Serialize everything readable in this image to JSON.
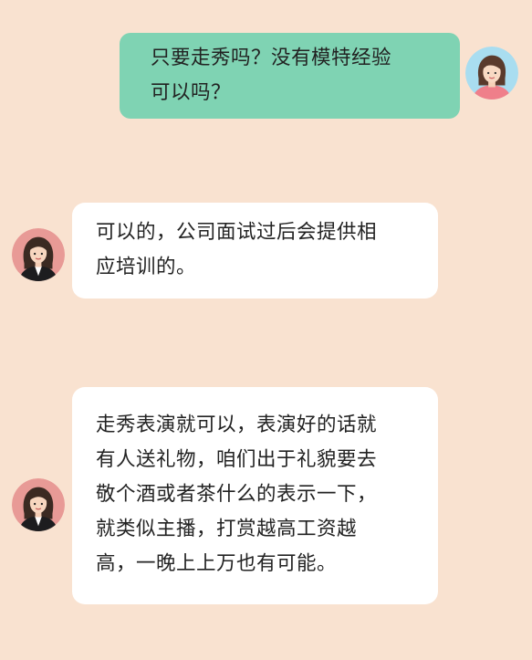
{
  "chat": {
    "messages": [
      {
        "sender": "user",
        "text": "只要走秀吗？没有模特经验\n可以吗？"
      },
      {
        "sender": "agent",
        "text": "可以的，公司面试过后会提供相\n应培训的。"
      },
      {
        "sender": "agent",
        "text": "走秀表演就可以，表演好的话就\n有人送礼物，咱们出于礼貌要去\n敬个酒或者茶什么的表示一下，\n就类似主播，打赏越高工资越\n高，一晚上上万也有可能。"
      }
    ]
  },
  "colors": {
    "background": "#f9e2d0",
    "user_bubble": "#7fd3b3",
    "agent_bubble": "#ffffff",
    "user_avatar_bg": "#a9ddf0",
    "agent_avatar_bg": "#e89a96"
  },
  "icons": {
    "user_avatar": "woman-avatar-icon",
    "agent_avatar": "businesswoman-avatar-icon"
  }
}
